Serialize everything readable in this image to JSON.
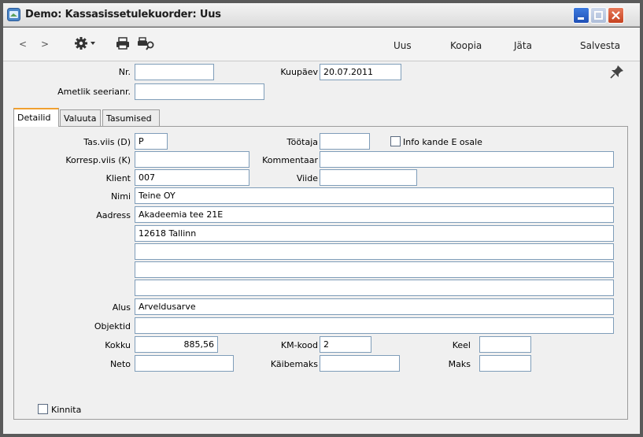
{
  "window": {
    "title": "Demo: Kassasissetulekuorder: Uus"
  },
  "toolbar": {
    "back": "<",
    "forward": ">",
    "new_label": "Uus",
    "copy_label": "Koopia",
    "skip_label": "Jäta",
    "save_label": "Salvesta"
  },
  "header": {
    "nr_label": "Nr.",
    "nr_value": "",
    "date_label": "Kuupäev",
    "date_value": "20.07.2011",
    "serial_label": "Ametlik seerianr.",
    "serial_value": ""
  },
  "tabs": [
    "Detailid",
    "Valuuta",
    "Tasumised"
  ],
  "form": {
    "payment_mode_label": "Tas.viis (D)",
    "payment_mode_value": "P",
    "employee_label": "Töötaja",
    "employee_value": "",
    "info_e_label": "Info kande E osale",
    "contra_label": "Korresp.viis (K)",
    "contra_value": "",
    "comment_label": "Kommentaar",
    "comment_value": "",
    "client_label": "Klient",
    "client_value": "007",
    "ref_label": "Viide",
    "ref_value": "",
    "name_label": "Nimi",
    "name_value": "Teine OY",
    "address_label": "Aadress",
    "address_lines": [
      "Akadeemia tee 21E",
      "12618 Tallinn",
      "",
      "",
      ""
    ],
    "basis_label": "Alus",
    "basis_value": "Arveldusarve",
    "objects_label": "Objektid",
    "objects_value": "",
    "total_label": "Kokku",
    "total_value": "885,56",
    "vat_code_label": "KM-kood",
    "vat_code_value": "2",
    "language_label": "Keel",
    "language_value": "",
    "net_label": "Neto",
    "net_value": "",
    "vat_label": "Käibemaks",
    "vat_value": "",
    "tax_label": "Maks",
    "tax_value": ""
  },
  "footer": {
    "approve_label": "Kinnita"
  },
  "colors": {
    "title_accent": "#4a86c8",
    "active_tab_accent": "#f0a030",
    "field_border": "#7f9db9"
  }
}
